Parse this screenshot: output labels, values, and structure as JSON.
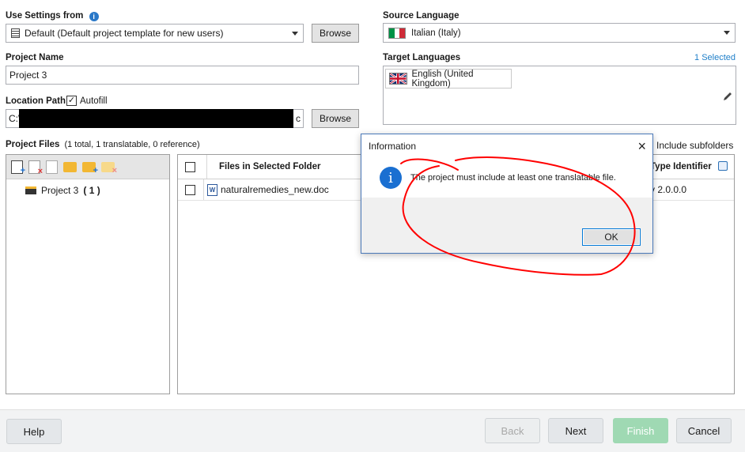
{
  "settings": {
    "label": "Use Settings from",
    "value": "Default (Default project template for new users)",
    "browse": "Browse"
  },
  "project_name": {
    "label": "Project Name",
    "value": "Project 3"
  },
  "location": {
    "label": "Location Path",
    "autofill_label": "Autofill",
    "value_start": "C:\\",
    "value_end": "c",
    "browse": "Browse"
  },
  "source": {
    "label": "Source Language",
    "value": "Italian (Italy)"
  },
  "target": {
    "label": "Target Languages",
    "count": "1 Selected",
    "languages": [
      "English (United Kingdom)"
    ]
  },
  "project_files": {
    "label": "Project Files",
    "summary": "(1 total, 1 translatable, 0 reference)",
    "include_subfolders": "Include subfolders",
    "tree_item": "Project 3",
    "tree_count": "( 1 )",
    "col_files": "Files in Selected Folder",
    "col_type": "Type Identifier",
    "rows": [
      {
        "name": "naturalremedies_new.doc",
        "type": "v 2.0.0.0"
      }
    ]
  },
  "dialog": {
    "title": "Information",
    "message": "The project must include at least one translatable file.",
    "ok": "OK"
  },
  "footer": {
    "help": "Help",
    "back": "Back",
    "next": "Next",
    "finish": "Finish",
    "cancel": "Cancel"
  },
  "colors": {
    "accent_link": "#1f7fc9",
    "finish_green": "#9fd9b3",
    "annotation_red": "#ff0000",
    "info_blue": "#1a6fd1"
  }
}
